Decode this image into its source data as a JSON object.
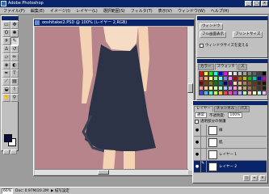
{
  "window": {
    "app_title": "Adobe Photoshop",
    "controls": {
      "minimize": "_",
      "maximize": "□",
      "close": "×"
    }
  },
  "menu": [
    "ファイル(F)",
    "編集(E)",
    "イメージ(I)",
    "レイヤー(L)",
    "選択範囲(S)",
    "フィルタ(T)",
    "表示(V)",
    "ウィンドウ(W)",
    "ヘルプ(H)"
  ],
  "document": {
    "title": "ooshitakei2.PSD @ 100% (レイヤー 2,RGB)",
    "canvas_color": "#b8848c"
  },
  "status": {
    "zoom": "66%",
    "doc_info": "Doc: 0.97M/20.2M",
    "hint": "▶ 描写設定"
  },
  "navigator_palette": {
    "fit_button": "ウィンドウ",
    "full_button": "フル画面表示",
    "print_button": "プリントサイズ",
    "checkbox_label": "ウィンドウサイズを変える"
  },
  "swatches_palette": {
    "tabs": [
      "カラー",
      "スウォッチ",
      "ス"
    ],
    "colors": [
      "#ff0000",
      "#ffff00",
      "#00ff00",
      "#00ffff",
      "#0000ff",
      "#ff00ff",
      "#ffffff",
      "#e0e0e0",
      "#c0c0c0",
      "#a0a0a0",
      "#808080",
      "#606060",
      "#404040",
      "#000000",
      "#ff6060",
      "#ffb060",
      "#ffff80",
      "#80ff80",
      "#60ffff",
      "#8080ff",
      "#ff80ff",
      "#c00000",
      "#c06000",
      "#c0c000",
      "#00c000",
      "#00c0c0",
      "#0000c0",
      "#c000c0",
      "#800000",
      "#804000",
      "#808000",
      "#008000",
      "#008080",
      "#000080",
      "#800080",
      "#ffd8b0",
      "#d8b080",
      "#b08050",
      "#805830",
      "#603818",
      "#402010",
      "#201008",
      "#ff9999",
      "#ffcc99",
      "#ffff99",
      "#ccff99",
      "#99ffcc",
      "#99ccff",
      "#cc99ff",
      "#ff99cc",
      "#e6c8a0",
      "#c8a078",
      "#a07850",
      "#785030",
      "#503018",
      "#281808",
      "#4040ff",
      "#40c0ff",
      "#40ffc0",
      "#c0ff40",
      "#ffc040",
      "#ff4040",
      "#ff40c0",
      "#c040ff",
      "#b0b0ff",
      "#b0ffb0",
      "#ffb0b0",
      "#ffffb0",
      "#b0ffff",
      "#ffb0ff"
    ]
  },
  "layers_palette": {
    "tabs": [
      "レイヤー",
      "チャンネル",
      "パス"
    ],
    "blend_mode": "通常",
    "opacity_label": "不透明度:",
    "opacity_value": "100%",
    "protect_label": "透明部分の保護",
    "layers": [
      {
        "name": "線",
        "visible": true,
        "active": false
      },
      {
        "name": "肌",
        "visible": true,
        "active": false
      },
      {
        "name": "レイヤー 1",
        "visible": true,
        "active": false
      },
      {
        "name": "レイヤー 2",
        "visible": true,
        "active": true
      }
    ]
  }
}
